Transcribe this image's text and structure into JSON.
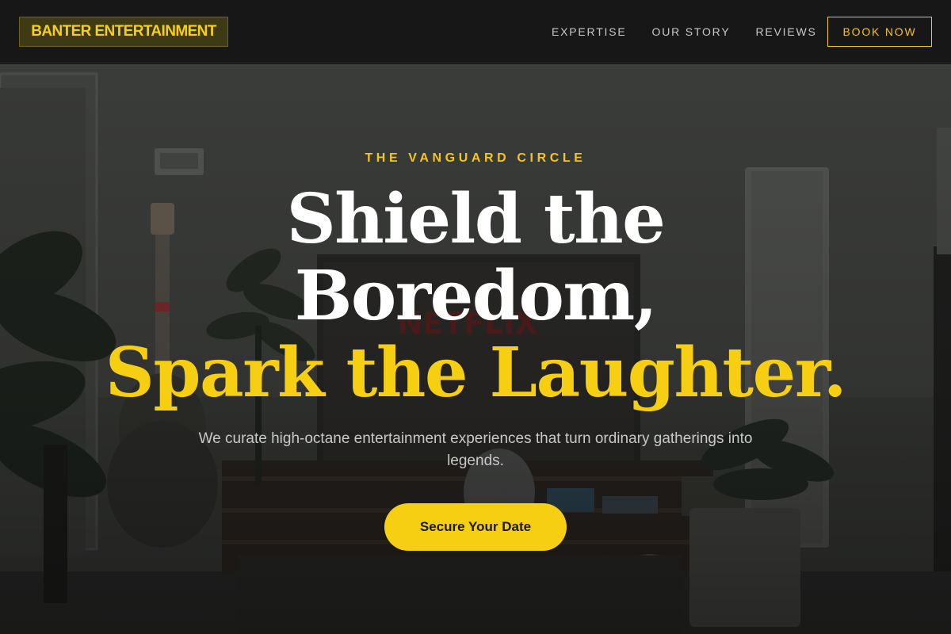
{
  "header": {
    "brand": "BANTER ENTERTAINMENT",
    "nav": [
      {
        "label": "EXPERTISE"
      },
      {
        "label": "OUR STORY"
      },
      {
        "label": "REVIEWS"
      }
    ],
    "cta_label": "BOOK NOW"
  },
  "hero": {
    "eyebrow": "THE VANGUARD CIRCLE",
    "headline_line1": "Shield the",
    "headline_line2": "Boredom,",
    "headline_line3": "Spark the Laughter.",
    "subtitle": "We curate high-octane entertainment experiences that turn ordinary gatherings into legends.",
    "cta_label": "Secure Your Date",
    "background_image": "dim living room with guitar, plants, TV and lamp"
  },
  "colors": {
    "accent": "#f5c518",
    "nav_bg": "#171717",
    "text_white": "#ffffff",
    "text_muted": "#c8c8c8"
  }
}
